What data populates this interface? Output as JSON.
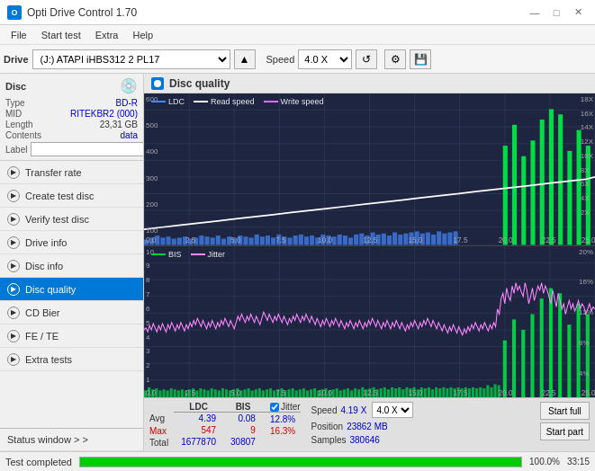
{
  "titlebar": {
    "title": "Opti Drive Control 1.70",
    "icon": "O",
    "min": "—",
    "max": "□",
    "close": "✕"
  },
  "menubar": {
    "items": [
      "File",
      "Start test",
      "Extra",
      "Help"
    ]
  },
  "toolbar": {
    "drive_label": "Drive",
    "drive_value": "(J:)  ATAPI iHBS312  2 PL17",
    "speed_label": "Speed",
    "speed_value": "4.0 X"
  },
  "disc": {
    "label": "Disc",
    "type_key": "Type",
    "type_val": "BD-R",
    "mid_key": "MID",
    "mid_val": "RITEKBR2 (000)",
    "length_key": "Length",
    "length_val": "23,31 GB",
    "contents_key": "Contents",
    "contents_val": "data",
    "label_key": "Label",
    "label_val": ""
  },
  "sidebar": {
    "items": [
      {
        "id": "transfer-rate",
        "label": "Transfer rate",
        "active": false
      },
      {
        "id": "create-test-disc",
        "label": "Create test disc",
        "active": false
      },
      {
        "id": "verify-test-disc",
        "label": "Verify test disc",
        "active": false
      },
      {
        "id": "drive-info",
        "label": "Drive info",
        "active": false
      },
      {
        "id": "disc-info",
        "label": "Disc info",
        "active": false
      },
      {
        "id": "disc-quality",
        "label": "Disc quality",
        "active": true
      },
      {
        "id": "cd-bier",
        "label": "CD Bier",
        "active": false
      },
      {
        "id": "fe-te",
        "label": "FE / TE",
        "active": false
      },
      {
        "id": "extra-tests",
        "label": "Extra tests",
        "active": false
      }
    ],
    "status_window": "Status window > >"
  },
  "chart": {
    "title": "Disc quality",
    "top_legend": [
      "LDC",
      "Read speed",
      "Write speed"
    ],
    "top_legend_colors": [
      "#3399ff",
      "#ffffff",
      "#ff66ff"
    ],
    "bottom_legend": [
      "BIS",
      "Jitter"
    ],
    "bottom_legend_colors": [
      "#00cc44",
      "#ff88ff"
    ],
    "x_max": "25.0",
    "right_y_top_max": "18X",
    "right_y_bottom_max": "20%"
  },
  "stats": {
    "headers": [
      "LDC",
      "BIS",
      "Jitter"
    ],
    "avg_label": "Avg",
    "avg_ldc": "4.39",
    "avg_bis": "0.08",
    "avg_jitter": "12.8%",
    "max_label": "Max",
    "max_ldc": "547",
    "max_bis": "9",
    "max_jitter": "16.3%",
    "total_label": "Total",
    "total_ldc": "1677870",
    "total_bis": "30807",
    "speed_label": "Speed",
    "speed_val": "4.19 X",
    "speed_select": "4.0 X",
    "position_label": "Position",
    "position_val": "23862 MB",
    "samples_label": "Samples",
    "samples_val": "380646",
    "start_full": "Start full",
    "start_part": "Start part"
  },
  "statusbar": {
    "text": "Test completed",
    "progress": "100.0%",
    "progress_val": 100,
    "time": "33:15"
  }
}
